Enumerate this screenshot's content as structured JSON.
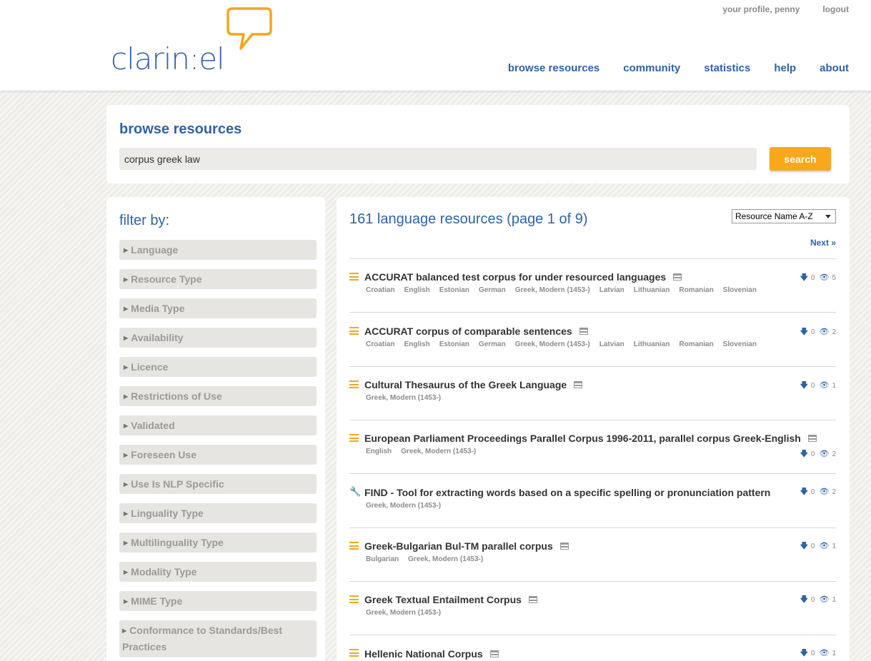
{
  "header": {
    "logo_text": "clarin:el",
    "user_links": {
      "profile": "your profile, penny",
      "logout": "logout"
    },
    "nav": [
      "browse resources",
      "community",
      "statistics",
      "help",
      "about"
    ]
  },
  "search": {
    "title": "browse resources",
    "query": "corpus greek law",
    "button": "search"
  },
  "filters": {
    "title": "filter by:",
    "items": [
      "Language",
      "Resource Type",
      "Media Type",
      "Availability",
      "Licence",
      "Restrictions of Use",
      "Validated",
      "Foreseen Use",
      "Use Is NLP Specific",
      "Linguality Type",
      "Multilinguality Type",
      "Modality Type",
      "MIME Type",
      "Conformance to Standards/Best Practices"
    ]
  },
  "results": {
    "title": "161 language resources (page 1 of 9)",
    "sort_value": "Resource Name A-Z",
    "next": "Next »",
    "items": [
      {
        "icon": "corpus-icon",
        "title": "ACCURAT balanced test corpus for under resourced languages",
        "langs": [
          "Croatian",
          "English",
          "Estonian",
          "German",
          "Greek, Modern (1453-)",
          "Latvian",
          "Lithuanian",
          "Romanian",
          "Slovenian"
        ],
        "downloads": "0",
        "views": "5"
      },
      {
        "icon": "corpus-icon",
        "title": "ACCURAT corpus of comparable sentences",
        "langs": [
          "Croatian",
          "English",
          "Estonian",
          "German",
          "Greek, Modern (1453-)",
          "Latvian",
          "Lithuanian",
          "Romanian",
          "Slovenian"
        ],
        "downloads": "0",
        "views": "2"
      },
      {
        "icon": "corpus-icon",
        "title": "Cultural Thesaurus of the Greek Language",
        "langs": [
          "Greek, Modern (1453-)"
        ],
        "downloads": "0",
        "views": "1"
      },
      {
        "icon": "corpus-icon",
        "title": "European Parliament Proceedings Parallel Corpus 1996-2011, parallel corpus Greek-English",
        "langs": [
          "English",
          "Greek, Modern (1453-)"
        ],
        "downloads": "0",
        "views": "2"
      },
      {
        "icon": "tool-icon",
        "title": "FIND - Tool for extracting words based on a specific spelling or pronunciation pattern",
        "langs": [
          "Greek, Modern (1453-)"
        ],
        "downloads": "0",
        "views": "2"
      },
      {
        "icon": "corpus-icon",
        "title": "Greek-Bulgarian Bul-TM parallel corpus",
        "langs": [
          "Bulgarian",
          "Greek, Modern (1453-)"
        ],
        "downloads": "0",
        "views": "1"
      },
      {
        "icon": "corpus-icon",
        "title": "Greek Textual Entailment Corpus",
        "langs": [
          "Greek, Modern (1453-)"
        ],
        "downloads": "0",
        "views": "1"
      },
      {
        "icon": "corpus-icon",
        "title": "Hellenic National Corpus",
        "langs": [],
        "downloads": "0",
        "views": "1"
      }
    ]
  }
}
